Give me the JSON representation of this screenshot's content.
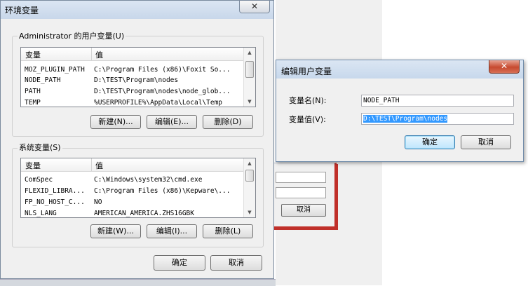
{
  "main_window": {
    "title": "环境变量",
    "close_glyph": "✕",
    "user_group": {
      "label": "Administrator 的用户变量(U)",
      "columns": [
        "变量",
        "值"
      ],
      "rows": [
        {
          "name": "MOZ_PLUGIN_PATH",
          "value": "C:\\Program Files (x86)\\Foxit So..."
        },
        {
          "name": "NODE_PATH",
          "value": "D:\\TEST\\Program\\nodes"
        },
        {
          "name": "PATH",
          "value": "D:\\TEST\\Program\\nodes\\node_glob..."
        },
        {
          "name": "TEMP",
          "value": "%USERPROFILE%\\AppData\\Local\\Temp"
        }
      ],
      "buttons": {
        "new": "新建(N)...",
        "edit": "编辑(E)...",
        "delete": "删除(D)"
      }
    },
    "system_group": {
      "label": "系统变量(S)",
      "columns": [
        "变量",
        "值"
      ],
      "rows": [
        {
          "name": "ComSpec",
          "value": "C:\\Windows\\system32\\cmd.exe"
        },
        {
          "name": "FLEXID_LIBRA...",
          "value": "C:\\Program Files (x86)\\Kepware\\..."
        },
        {
          "name": "FP_NO_HOST_C...",
          "value": "NO"
        },
        {
          "name": "NLS_LANG",
          "value": "AMERICAN_AMERICA.ZHS16GBK"
        }
      ],
      "buttons": {
        "new": "新建(W)...",
        "edit": "编辑(I)...",
        "delete": "删除(L)"
      }
    },
    "ok": "确定",
    "cancel": "取消"
  },
  "scroll_arrows": {
    "up": "▲",
    "down": "▼"
  },
  "behind_dialog": {
    "cancel": "取消"
  },
  "edit_dialog": {
    "title": "编辑用户变量",
    "close_glyph": "✕",
    "name_label": "变量名(N):",
    "value_label": "变量值(V):",
    "name_value": "NODE_PATH",
    "value_value": "D:\\TEST\\Program\\nodes",
    "ok": "确定",
    "cancel": "取消"
  }
}
